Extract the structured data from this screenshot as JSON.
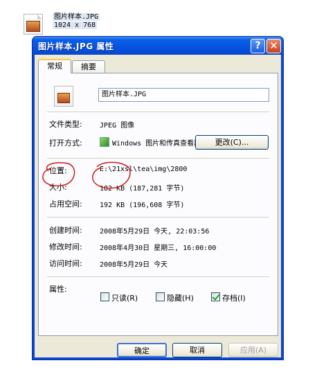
{
  "desktop_file": {
    "name": "图片样本.JPG",
    "dimensions": "1024 x 768"
  },
  "window": {
    "title": "图片样本.JPG 属性",
    "help_label": "?",
    "close_label": "✕"
  },
  "tabs": [
    {
      "label": "常规",
      "active": true
    },
    {
      "label": "摘要",
      "active": false
    }
  ],
  "general": {
    "file_name": "图片样本.JPG",
    "type_label": "文件类型:",
    "type_value": "JPEG 图像",
    "open_with_label": "打开方式:",
    "open_with_value": "Windows 图片和传真查看器",
    "change_button": "更改(C)...",
    "location_label": "位置:",
    "location_value": "E:\\21xsl\\tea\\img\\2800",
    "size_label": "大小:",
    "size_value": "182 KB (187,281 字节)",
    "size_on_disk_label": "占用空间:",
    "size_on_disk_value": "192 KB (196,608 字节)",
    "created_label": "创建时间:",
    "created_value": "2008年5月29日 今天, 22:03:56",
    "modified_label": "修改时间:",
    "modified_value": "2008年4月30日 星期三, 16:00:00",
    "accessed_label": "访问时间:",
    "accessed_value": "2008年5月29日 今天",
    "attributes_label": "属性:",
    "attributes": [
      {
        "label": "只读(R)",
        "checked": false
      },
      {
        "label": "隐藏(H)",
        "checked": false
      },
      {
        "label": "存档(I)",
        "checked": true
      }
    ]
  },
  "footer": {
    "ok": "确定",
    "cancel": "取消",
    "apply": "应用(A)"
  },
  "colors": {
    "titlebar": "#0a5fe6",
    "dialog_body": "#ece9d8",
    "annotation": "#d01818"
  }
}
